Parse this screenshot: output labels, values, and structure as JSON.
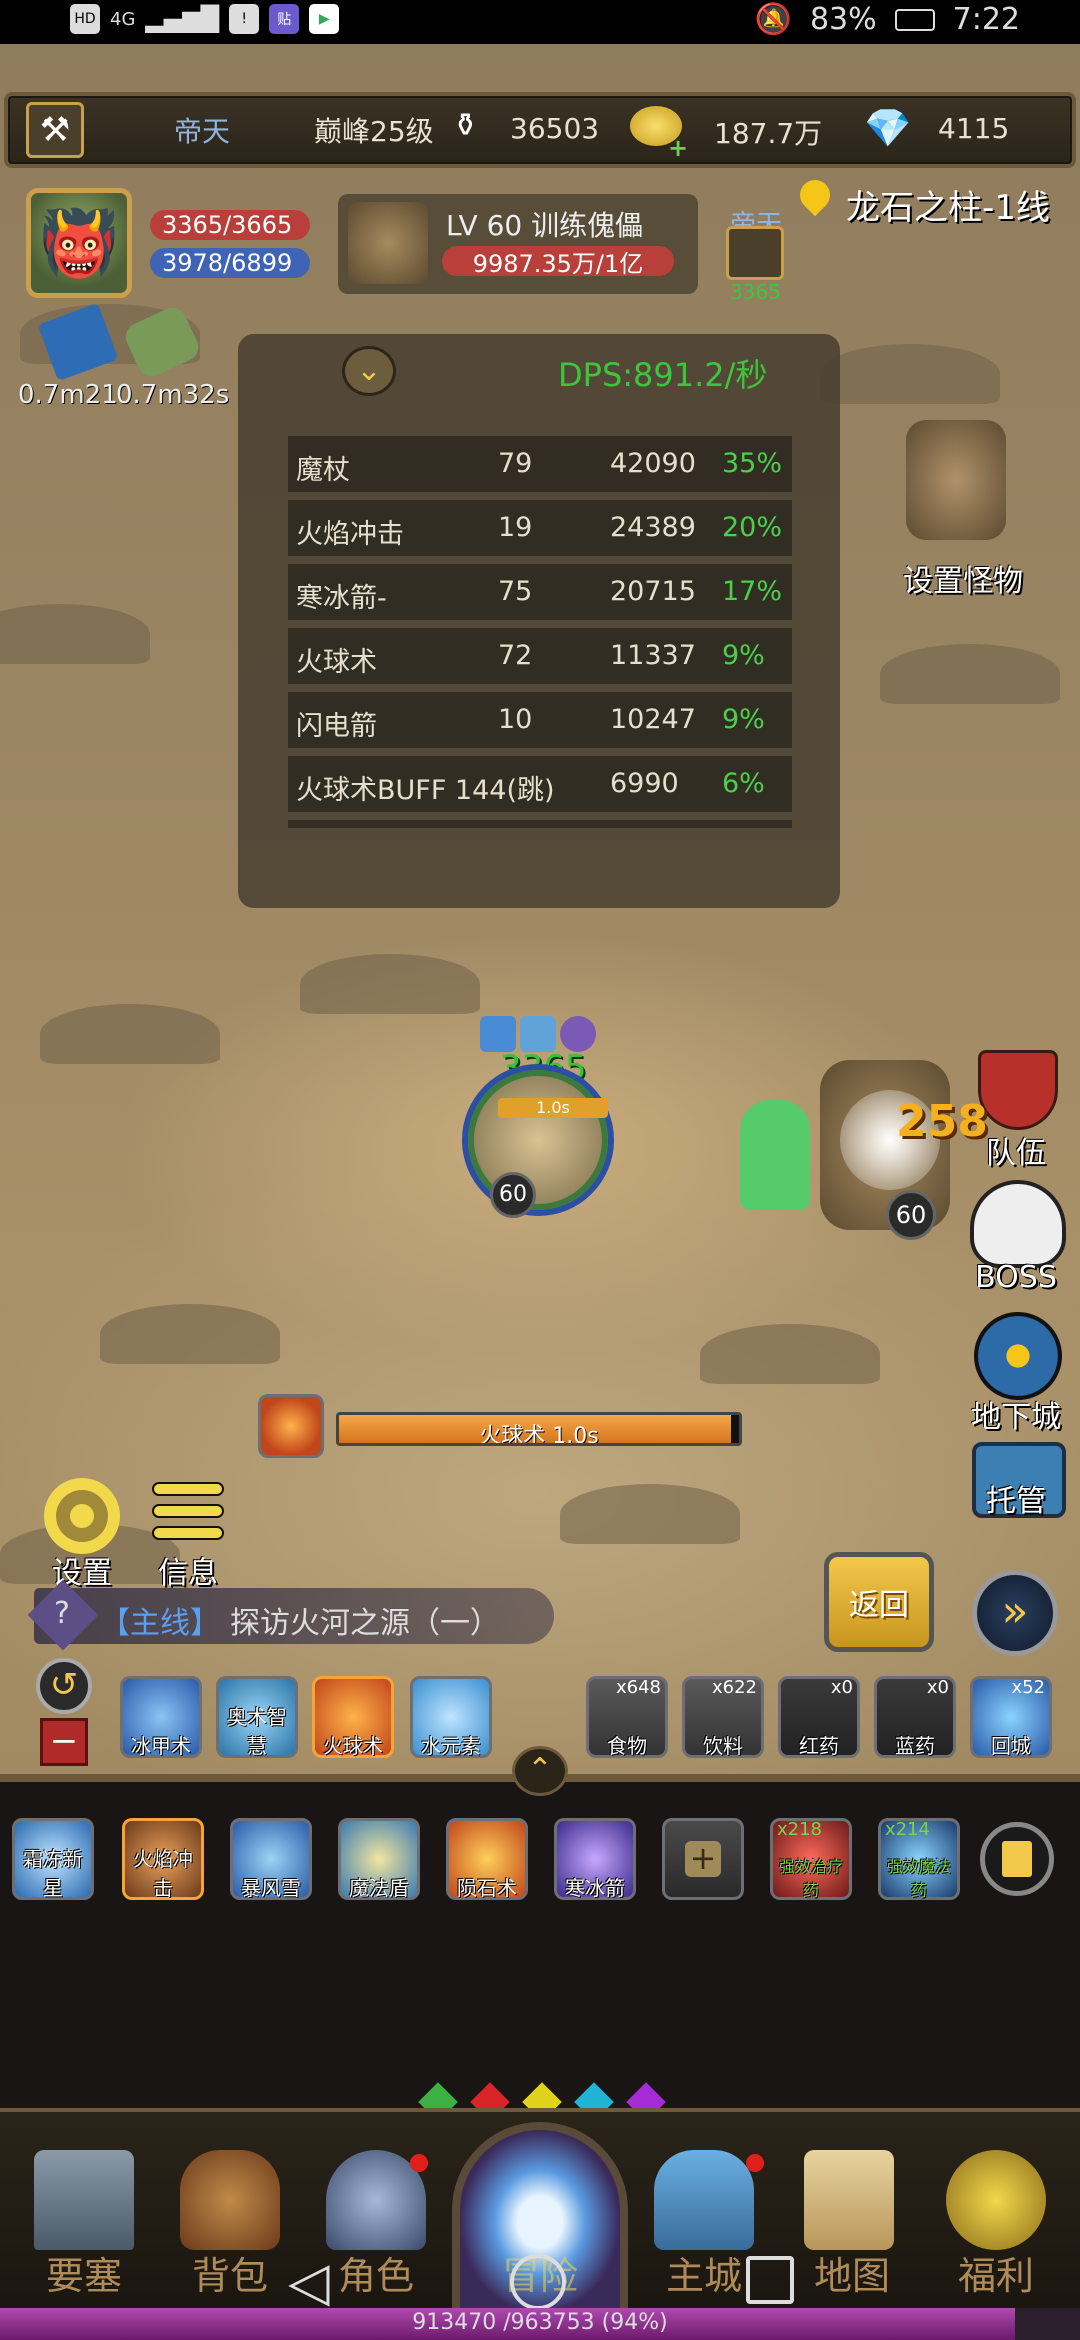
{
  "status_bar": {
    "network": "4G",
    "battery": "83%",
    "time": "7:22"
  },
  "top_bar": {
    "player_name": "帝天",
    "rank": "巅峰25级",
    "honor": "36503",
    "gold": "187.7万",
    "diamonds": "4115"
  },
  "player": {
    "hp": "3365/3665",
    "mp": "3978/6899",
    "timer1": "0.7m21",
    "timer2": "0.7m32s"
  },
  "target": {
    "level_name": "LV 60 训练傀儡",
    "hp": "9987.35万/1亿",
    "party_member": "帝天",
    "party_value": "3365"
  },
  "location": "龙石之柱-1线",
  "dps": {
    "title": "DPS:891.2/秒",
    "rows": [
      {
        "skill": "魔杖",
        "hits": "79",
        "damage": "42090",
        "pct": "35%"
      },
      {
        "skill": "火焰冲击",
        "hits": "19",
        "damage": "24389",
        "pct": "20%"
      },
      {
        "skill": "寒冰箭-",
        "hits": "75",
        "damage": "20715",
        "pct": "17%"
      },
      {
        "skill": "火球术",
        "hits": "72",
        "damage": "11337",
        "pct": "9%"
      },
      {
        "skill": "闪电箭",
        "hits": "10",
        "damage": "10247",
        "pct": "9%"
      },
      {
        "skill": "火球术BUFF 144(跳)",
        "hits": "",
        "damage": "6990",
        "pct": "6%"
      }
    ]
  },
  "side_menu": {
    "set_monster": "设置怪物",
    "team": "队伍",
    "boss": "BOSS",
    "dungeon": "地下城",
    "auto": "托管"
  },
  "battle": {
    "player_hp_float": "3365",
    "player_level": "60",
    "cast_timer": "1.0s",
    "enemy_level": "60",
    "damage_float": "258",
    "cast_bar_label": "火球术 1.0s",
    "cast_progress": 0.98
  },
  "controls": {
    "settings": "设置",
    "info": "信息",
    "back": "返回"
  },
  "quest": {
    "tag": "【主线】",
    "text": "探访火河之源（一）"
  },
  "buff_skills": [
    "冰甲术",
    "奥术智慧",
    "火球术",
    "水元素"
  ],
  "consumables": [
    {
      "name": "食物",
      "count": "x648"
    },
    {
      "name": "饮料",
      "count": "x622"
    },
    {
      "name": "红药",
      "count": "x0"
    },
    {
      "name": "蓝药",
      "count": "x0"
    },
    {
      "name": "回城",
      "count": "x52"
    }
  ],
  "skill_bar": [
    {
      "name": "霜冻新星"
    },
    {
      "name": "火焰冲击"
    },
    {
      "name": "暴风雪"
    },
    {
      "name": "魔法盾"
    },
    {
      "name": "陨石术"
    },
    {
      "name": "寒冰箭"
    }
  ],
  "potions": [
    {
      "name": "强效治疗药",
      "count": "x218"
    },
    {
      "name": "强效魔法药",
      "count": "x214"
    }
  ],
  "nav": [
    "要塞",
    "背包",
    "角色",
    "冒险",
    "主城",
    "地图",
    "福利"
  ],
  "exp": {
    "text": "913470 /963753 (94%)",
    "progress": 0.94
  },
  "colors": {
    "gem_1": "#3cb043",
    "gem_2": "#d9252a",
    "gem_3": "#e0d21a",
    "gem_4": "#1fb3d6",
    "gem_5": "#a52bd6"
  }
}
